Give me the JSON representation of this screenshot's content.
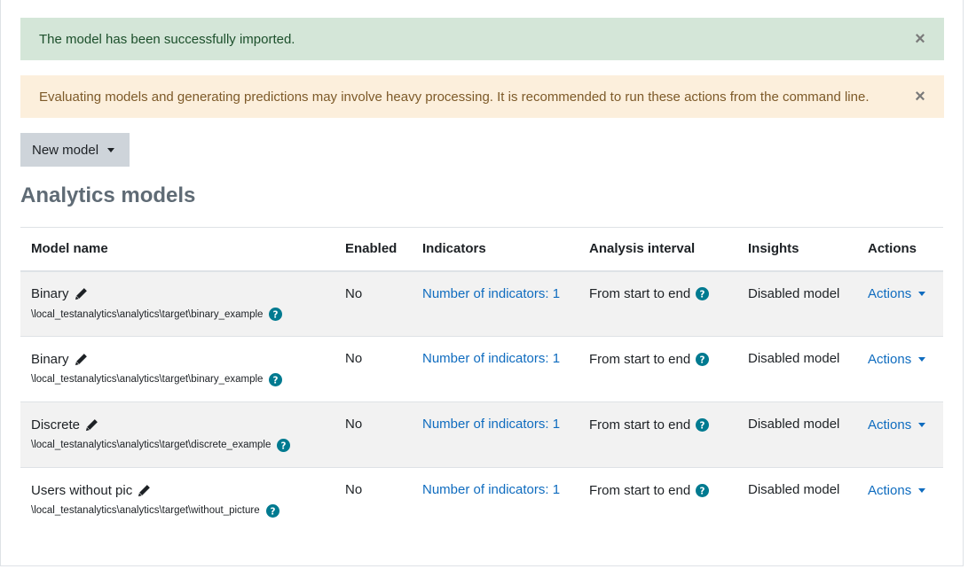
{
  "alerts": {
    "success": {
      "message": "The model has been successfully imported.",
      "close": "×"
    },
    "warning": {
      "message": "Evaluating models and generating predictions may involve heavy processing. It is recommended to run these actions from the command line.",
      "close": "×"
    }
  },
  "new_model_button": {
    "label": "New model"
  },
  "page_title": "Analytics models",
  "table": {
    "headers": {
      "name": "Model name",
      "enabled": "Enabled",
      "indicators": "Indicators",
      "interval": "Analysis interval",
      "insights": "Insights",
      "actions": "Actions"
    },
    "rows": [
      {
        "name": "Binary",
        "target": "\\local_testanalytics\\analytics\\target\\binary_example",
        "enabled": "No",
        "indicators": "Number of indicators: 1",
        "interval": "From start to end",
        "insights": "Disabled model",
        "actions": "Actions"
      },
      {
        "name": "Binary",
        "target": "\\local_testanalytics\\analytics\\target\\binary_example",
        "enabled": "No",
        "indicators": "Number of indicators: 1",
        "interval": "From start to end",
        "insights": "Disabled model",
        "actions": "Actions"
      },
      {
        "name": "Discrete",
        "target": "\\local_testanalytics\\analytics\\target\\discrete_example",
        "enabled": "No",
        "indicators": "Number of indicators: 1",
        "interval": "From start to end",
        "insights": "Disabled model",
        "actions": "Actions"
      },
      {
        "name": "Users without pic",
        "target": "\\local_testanalytics\\analytics\\target\\without_picture",
        "enabled": "No",
        "indicators": "Number of indicators: 1",
        "interval": "From start to end",
        "insights": "Disabled model",
        "actions": "Actions"
      }
    ]
  },
  "icons": {
    "edit": "pencil-icon",
    "help": "question-circle-icon",
    "close": "close-icon",
    "dropdown": "caret-down-icon"
  },
  "colors": {
    "link": "#0f6cbf",
    "help_icon": "#007a90",
    "success_bg": "#d4e6d8",
    "warning_bg": "#fcefdc"
  }
}
